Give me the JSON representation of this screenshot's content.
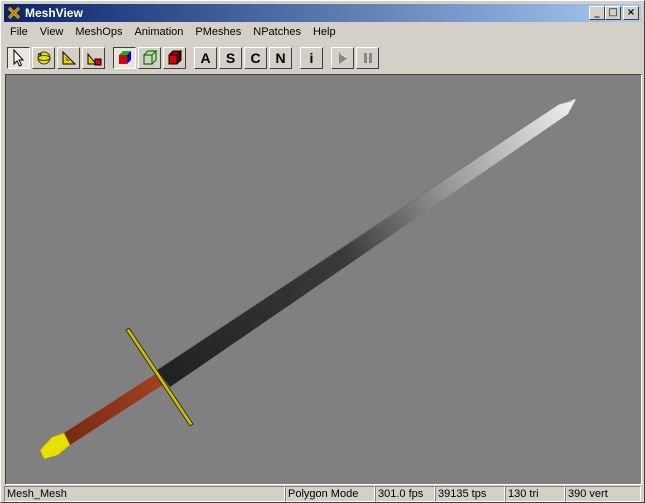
{
  "window": {
    "title": "MeshView"
  },
  "titlebar_buttons": {
    "minimize": "_",
    "maximize": "□",
    "close": "×"
  },
  "menu": [
    "File",
    "View",
    "MeshOps",
    "Animation",
    "PMeshes",
    "NPatches",
    "Help"
  ],
  "toolbar": {
    "letters": [
      "A",
      "S",
      "C",
      "N"
    ],
    "info": "i",
    "icons": [
      "arrow-select-icon",
      "rotate-sphere-icon",
      "translate-icon",
      "scale-icon",
      "solid-cube-icon",
      "wireframe-cube-icon",
      "shaded-cube-icon",
      "play-icon",
      "pause-icon"
    ]
  },
  "colors": {
    "title_start": "#0a246a",
    "title_end": "#a6caf0",
    "viewport_bg": "#808080"
  },
  "status": {
    "mesh": "Mesh_Mesh",
    "mode": "Polygon Mode",
    "fps": "301.0 fps",
    "tps": "39135 tps",
    "tri": "130 tri",
    "vert": "390 vert"
  }
}
